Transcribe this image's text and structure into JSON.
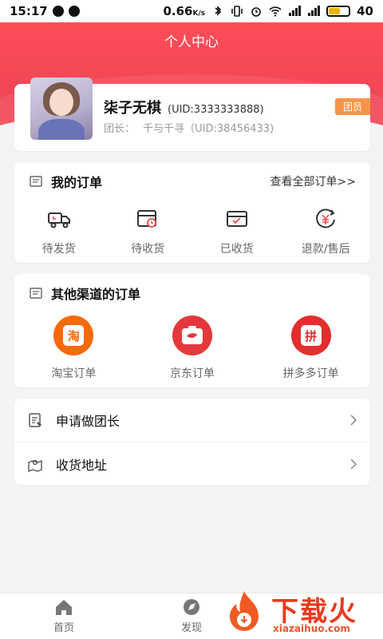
{
  "status_bar": {
    "time": "15:17",
    "network_speed": "0.66",
    "speed_unit": "K/s",
    "battery": "40"
  },
  "header": {
    "title": "个人中心"
  },
  "profile": {
    "name": "柒子无棋",
    "uid": "(UID:3333333888)",
    "leader_label": "团长：",
    "leader_info": "千与千寻（UID:38456433)",
    "badge": "团员"
  },
  "orders": {
    "title": "我的订单",
    "view_all": "查看全部订单>>",
    "items": [
      {
        "label": "待发货",
        "icon": "truck-icon"
      },
      {
        "label": "待收货",
        "icon": "box-clock-icon"
      },
      {
        "label": "已收货",
        "icon": "box-check-icon"
      },
      {
        "label": "退款/售后",
        "icon": "yen-refund-icon"
      }
    ]
  },
  "channels": {
    "title": "其他渠道的订单",
    "items": [
      {
        "label": "淘宝订单",
        "glyph": "淘",
        "color": "#f76a0c"
      },
      {
        "label": "京东订单",
        "glyph": "",
        "color": "#e4393c"
      },
      {
        "label": "拼多多订单",
        "glyph": "拼",
        "color": "#e22e2e"
      }
    ]
  },
  "menu": {
    "items": [
      {
        "label": "申请做团长",
        "icon": "apply-form-icon"
      },
      {
        "label": "收货地址",
        "icon": "map-pin-icon"
      }
    ]
  },
  "tabs": [
    {
      "label": "首页",
      "icon": "home-icon"
    },
    {
      "label": "发现",
      "icon": "compass-icon"
    }
  ],
  "watermark": {
    "title": "下载火",
    "domain": "xiazaihuo.com"
  },
  "colors": {
    "accent": "#f04656",
    "badge": "#f7944a"
  }
}
